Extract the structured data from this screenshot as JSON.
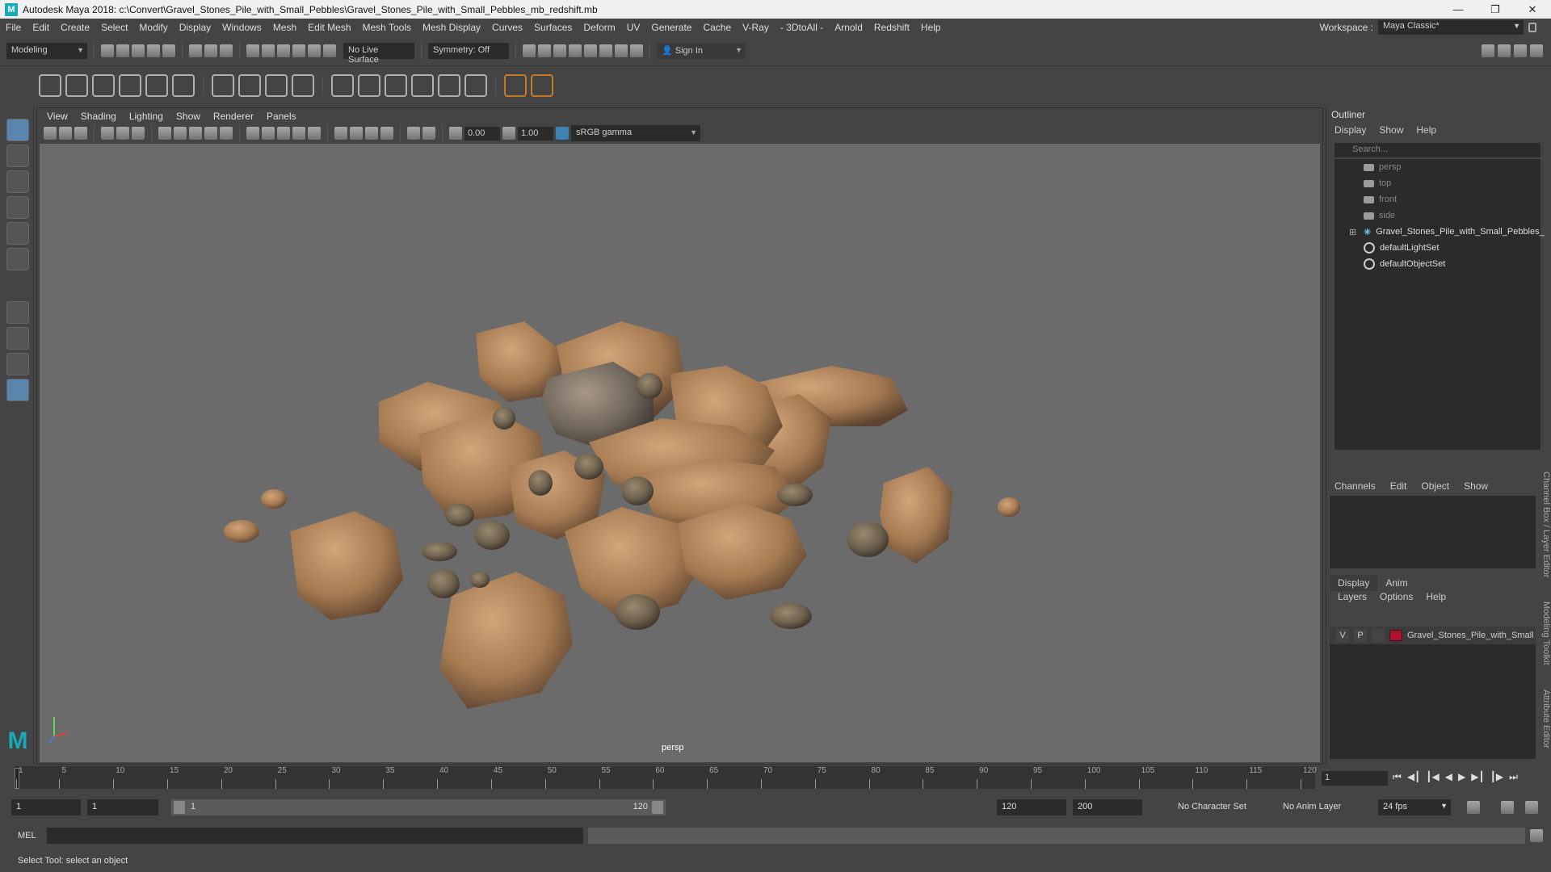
{
  "title": "Autodesk Maya 2018: c:\\Convert\\Gravel_Stones_Pile_with_Small_Pebbles\\Gravel_Stones_Pile_with_Small_Pebbles_mb_redshift.mb",
  "menu": [
    "File",
    "Edit",
    "Create",
    "Select",
    "Modify",
    "Display",
    "Windows",
    "Mesh",
    "Edit Mesh",
    "Mesh Tools",
    "Mesh Display",
    "Curves",
    "Surfaces",
    "Deform",
    "UV",
    "Generate",
    "Cache",
    "V-Ray",
    "- 3DtoAll -",
    "Arnold",
    "Redshift",
    "Help"
  ],
  "workspace": {
    "label": "Workspace :",
    "value": "Maya Classic*"
  },
  "status": {
    "mode": "Modeling",
    "live_surface": "No Live Surface",
    "symmetry": "Symmetry: Off",
    "sign_in": "Sign In"
  },
  "panel": {
    "menu": [
      "View",
      "Shading",
      "Lighting",
      "Show",
      "Renderer",
      "Panels"
    ],
    "exposure": "0.00",
    "gamma": "1.00",
    "colorspace": "sRGB gamma",
    "camera": "persp"
  },
  "outliner": {
    "title": "Outliner",
    "menu": [
      "Display",
      "Show",
      "Help"
    ],
    "search_placeholder": "Search...",
    "items": [
      {
        "label": "persp",
        "icon": "camera-icon",
        "dim": true
      },
      {
        "label": "top",
        "icon": "camera-icon",
        "dim": true
      },
      {
        "label": "front",
        "icon": "camera-icon",
        "dim": true
      },
      {
        "label": "side",
        "icon": "camera-icon",
        "dim": true
      },
      {
        "label": "Gravel_Stones_Pile_with_Small_Pebbles_",
        "icon": "group-icon",
        "dim": false
      },
      {
        "label": "defaultLightSet",
        "icon": "set-icon",
        "dim": false
      },
      {
        "label": "defaultObjectSet",
        "icon": "set-icon",
        "dim": false
      }
    ]
  },
  "channelbox": {
    "menu": [
      "Channels",
      "Edit",
      "Object",
      "Show"
    ],
    "tabs": [
      "Display",
      "Anim"
    ],
    "layer_menu": [
      "Layers",
      "Options",
      "Help"
    ],
    "layer": {
      "v": "V",
      "p": "P",
      "name": "Gravel_Stones_Pile_with_Small",
      "color": "#b2102f"
    },
    "side_tabs": [
      "Channel Box / Layer Editor",
      "Modeling Toolkit",
      "Attribute Editor"
    ]
  },
  "timeline": {
    "ticks": [
      "1",
      "5",
      "10",
      "15",
      "20",
      "25",
      "30",
      "35",
      "40",
      "45",
      "50",
      "55",
      "60",
      "65",
      "70",
      "75",
      "80",
      "85",
      "90",
      "95",
      "100",
      "105",
      "110",
      "115",
      "120"
    ],
    "current_frame": "1"
  },
  "range": {
    "start": "1",
    "playback_start": "1",
    "bar_start": "1",
    "bar_end": "120",
    "playback_end": "120",
    "end": "200",
    "character_set": "No Character Set",
    "anim_layer": "No Anim Layer",
    "fps": "24 fps"
  },
  "cmdline": {
    "label": "MEL"
  },
  "helpline": "Select Tool: select an object",
  "colors": {
    "accent": "#5a86ad",
    "maya_teal": "#18aab8",
    "layer_red": "#b2102f"
  }
}
